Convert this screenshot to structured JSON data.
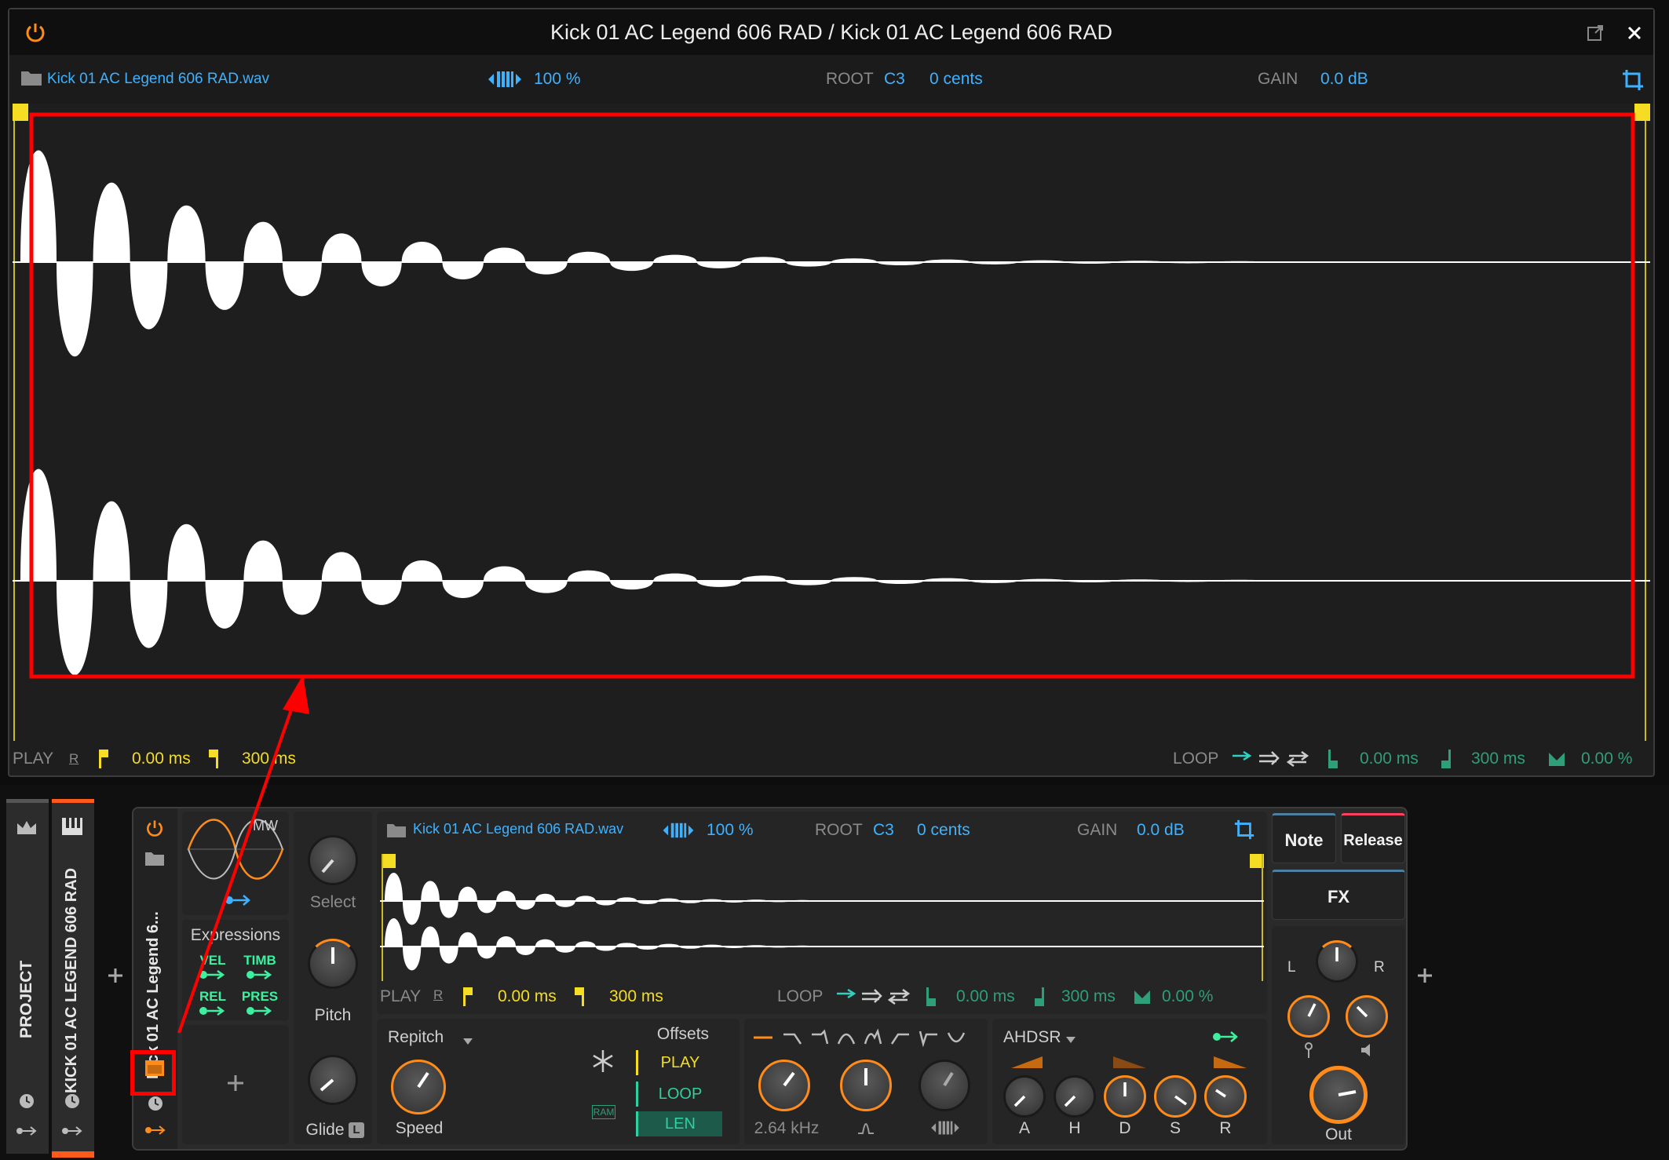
{
  "editor": {
    "title": "Kick 01 AC Legend 606 RAD / Kick 01 AC Legend 606 RAD",
    "file_name": "Kick 01 AC Legend 606 RAD.wav",
    "speed": "100 %",
    "root_label": "ROOT",
    "root_note": "C3",
    "cents": "0 cents",
    "gain_label": "GAIN",
    "gain_value": "0.0 dB",
    "play_label": "PLAY",
    "r_label": "R",
    "play_start": "0.00 ms",
    "play_end": "300 ms",
    "loop_label": "LOOP",
    "loop_start": "0.00 ms",
    "loop_end": "300 ms",
    "loop_fade": "0.00 %"
  },
  "tracks": {
    "project": "PROJECT",
    "track_name": "KICK 01 AC LEGEND 606 RAD",
    "device_name": "Kick 01 AC Legend 6..."
  },
  "device": {
    "mw_label": "MW",
    "expressions_title": "Expressions",
    "expr_vel": "VEL",
    "expr_timb": "TIMB",
    "expr_rel": "REL",
    "expr_pres": "PRES",
    "select_label": "Select",
    "pitch_label": "Pitch",
    "glide_label": "Glide",
    "glide_badge": "L",
    "file_name": "Kick 01 AC Legend 606 RAD.wav",
    "speed": "100 %",
    "root_label": "ROOT",
    "root_note": "C3",
    "cents": "0 cents",
    "gain_label": "GAIN",
    "gain_value": "0.0 dB",
    "play_label": "PLAY",
    "r_label": "R",
    "play_start": "0.00 ms",
    "play_end": "300 ms",
    "loop_label": "LOOP",
    "loop_start": "0.00 ms",
    "loop_end": "300 ms",
    "loop_fade": "0.00 %",
    "mode": "Repitch",
    "speed_label": "Speed",
    "ram_label": "RAM",
    "offsets_title": "Offsets",
    "offset_play": "PLAY",
    "offset_loop": "LOOP",
    "offset_len": "LEN",
    "filter_freq": "2.64 kHz",
    "envelope_type": "AHDSR",
    "env_a": "A",
    "env_h": "H",
    "env_d": "D",
    "env_s": "S",
    "env_r": "R",
    "note_btn": "Note",
    "release_btn": "Release",
    "fx_btn": "FX",
    "pan_l": "L",
    "pan_r": "R",
    "out_label": "Out"
  },
  "colors": {
    "accent_blue": "#3fb2ff",
    "accent_orange": "#ff8c1a",
    "marker_yellow": "#f4dd22",
    "loop_teal": "#2e9f78",
    "highlight_red": "#ff0000"
  }
}
